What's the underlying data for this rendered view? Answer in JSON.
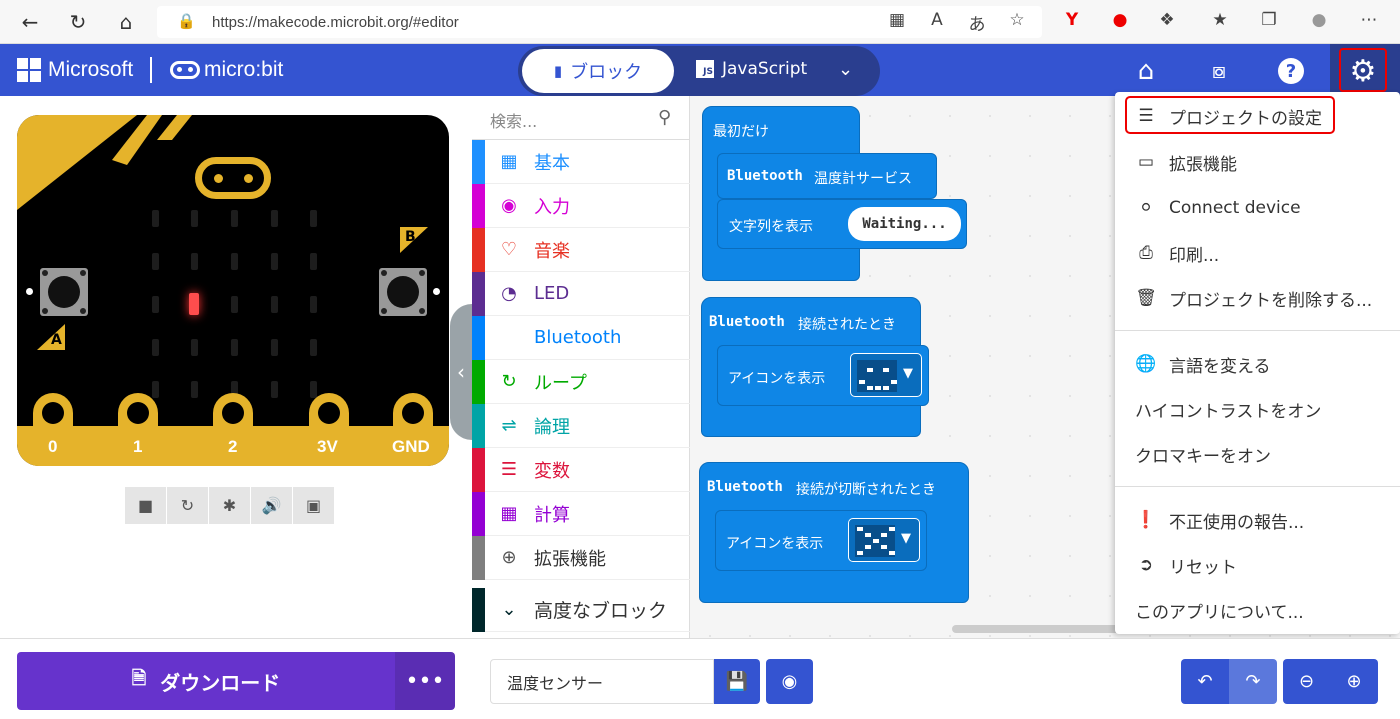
{
  "browser": {
    "url": "https://makecode.microbit.org/#editor"
  },
  "header": {
    "brand": "Microsoft",
    "product": "micro:bit",
    "tab_blocks": "ブロック",
    "tab_js": "JavaScript",
    "js_badge": "JS"
  },
  "simulator": {
    "pins": [
      "0",
      "1",
      "2",
      "3V",
      "GND"
    ],
    "button_a": "A",
    "button_b": "B"
  },
  "toolbox": {
    "search_placeholder": "検索...",
    "categories": [
      {
        "label": "基本",
        "color": "#1e90ff"
      },
      {
        "label": "入力",
        "color": "#d400d4"
      },
      {
        "label": "音楽",
        "color": "#e63022"
      },
      {
        "label": "LED",
        "color": "#5c2d91"
      },
      {
        "label": "Bluetooth",
        "color": "#0082fb"
      },
      {
        "label": "ループ",
        "color": "#00aa00"
      },
      {
        "label": "論理",
        "color": "#00a4a6"
      },
      {
        "label": "変数",
        "color": "#dc143c"
      },
      {
        "label": "計算",
        "color": "#9400d3"
      },
      {
        "label": "拡張機能",
        "color": "#7f7f7f"
      },
      {
        "label": "高度なブロック",
        "color": "#00272b"
      }
    ]
  },
  "workspace": {
    "block1": {
      "hat": "最初だけ",
      "stmt1": "Bluetooth 温度計サービス",
      "stmt1_mono": "Bluetooth",
      "stmt1_rest": "温度計サービス",
      "stmt2": "文字列を表示",
      "stmt2_value": "Waiting..."
    },
    "block2": {
      "hat_mono": "Bluetooth",
      "hat_rest": "接続されたとき",
      "stmt": "アイコンを表示"
    },
    "block3": {
      "hat_mono": "Bluetooth",
      "hat_rest": "接続が切断されたとき",
      "stmt": "アイコンを表示"
    }
  },
  "menu": {
    "items": [
      {
        "label": "プロジェクトの設定",
        "icon": "sliders-icon"
      },
      {
        "label": "拡張機能",
        "icon": "drive-icon"
      },
      {
        "label": "Connect device",
        "icon": "link-icon"
      },
      {
        "label": "印刷...",
        "icon": "print-icon"
      },
      {
        "label": "プロジェクトを削除する...",
        "icon": "trash-icon"
      },
      {
        "label": "言語を変える",
        "icon": "globe-icon"
      },
      {
        "label": "ハイコントラストをオン"
      },
      {
        "label": "クロマキーをオン"
      },
      {
        "label": "不正使用の報告...",
        "icon": "alert-icon"
      },
      {
        "label": "リセット",
        "icon": "signout-icon"
      },
      {
        "label": "このアプリについて..."
      }
    ]
  },
  "bottom": {
    "download": "ダウンロード",
    "more": "•••",
    "project_name": "温度センサー"
  },
  "colors": {
    "header": "#3454d1",
    "block": "#0f86e6",
    "download": "#6633cc"
  }
}
